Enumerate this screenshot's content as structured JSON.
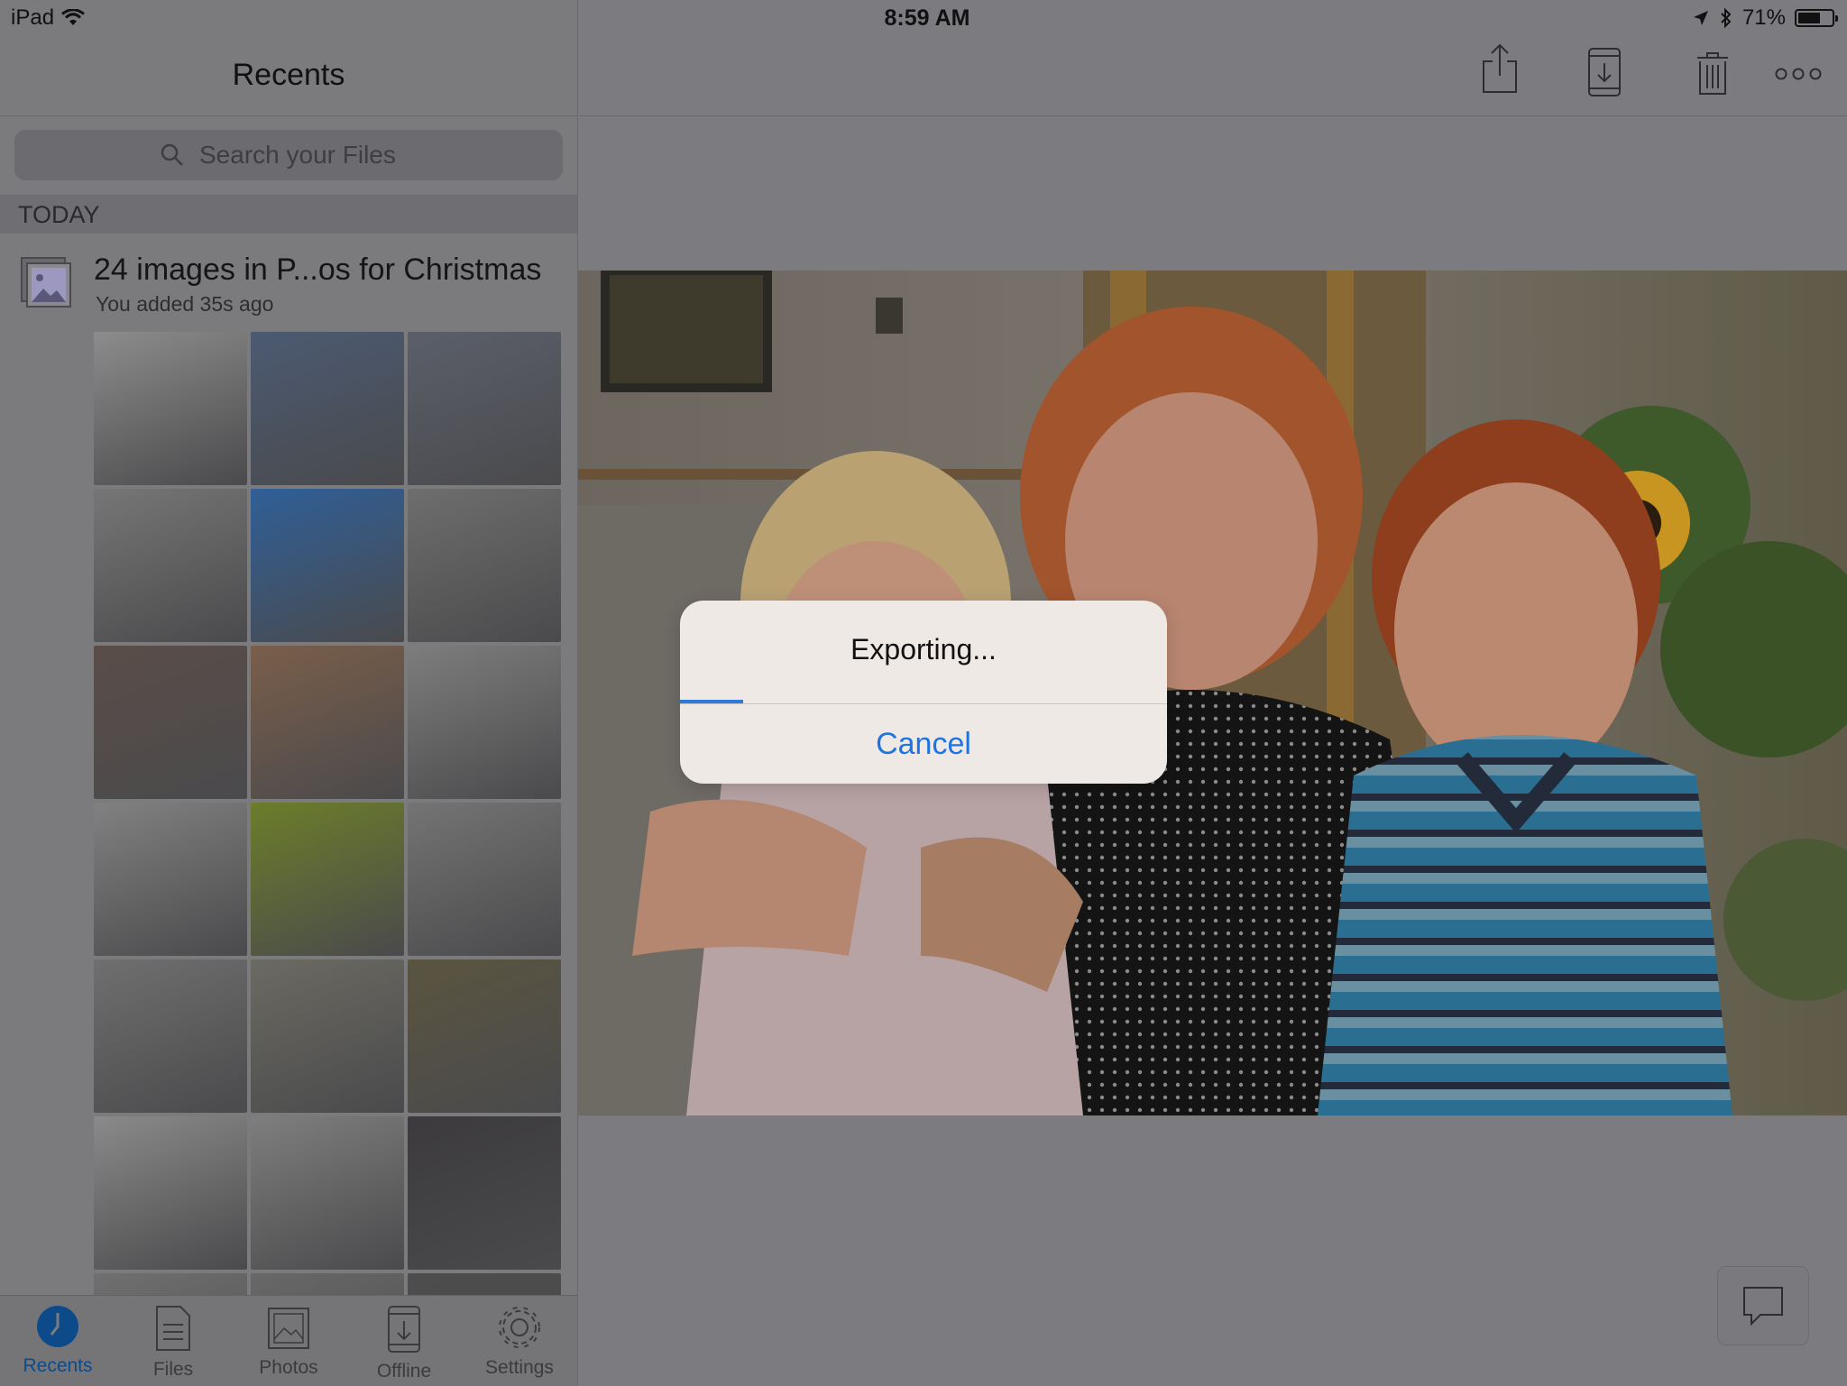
{
  "status_bar": {
    "device": "iPad",
    "time": "8:59 AM",
    "battery_percent": "71%",
    "battery_level": 0.71,
    "icons": [
      "wifi-icon",
      "location-arrow-icon",
      "bluetooth-icon",
      "battery-icon"
    ]
  },
  "sidebar": {
    "title": "Recents",
    "search": {
      "placeholder": "Search your Files",
      "value": ""
    },
    "section": "TODAY",
    "recent_item": {
      "title": "24 images in P...os for Christmas",
      "subtitle": "You added 35s ago"
    },
    "thumbnails": [
      {
        "color": "#8c8c8c"
      },
      {
        "color": "#4b5a72"
      },
      {
        "color": "#5b5f6a"
      },
      {
        "color": "#767676"
      },
      {
        "color": "#2f5f98"
      },
      {
        "color": "#6e6e6e"
      },
      {
        "color": "#5a4d48"
      },
      {
        "color": "#7a5e4a"
      },
      {
        "color": "#7d7d7d"
      },
      {
        "color": "#818181"
      },
      {
        "color": "#6c7d2a"
      },
      {
        "color": "#747474"
      },
      {
        "color": "#6f6f6f"
      },
      {
        "color": "#6b6a62"
      },
      {
        "color": "#5a5540"
      },
      {
        "color": "#8a8a8a"
      },
      {
        "color": "#7e7e7e"
      },
      {
        "color": "#3c3a3d"
      },
      {
        "color": "#707070"
      },
      {
        "color": "#686868"
      },
      {
        "color": "#4d4d4d"
      }
    ]
  },
  "tabs": [
    {
      "label": "Recents",
      "icon": "clock-icon",
      "active": true
    },
    {
      "label": "Files",
      "icon": "files-icon",
      "active": false
    },
    {
      "label": "Photos",
      "icon": "photos-icon",
      "active": false
    },
    {
      "label": "Offline",
      "icon": "offline-icon",
      "active": false
    },
    {
      "label": "Settings",
      "icon": "gear-icon",
      "active": false
    }
  ],
  "toolbar": {
    "icons": [
      "share-icon",
      "save-to-device-icon",
      "trash-icon",
      "more-icon"
    ]
  },
  "alert": {
    "title": "Exporting...",
    "cancel_label": "Cancel",
    "progress": 0.13
  },
  "colors": {
    "accent": "#1e74e0",
    "overlay_gray": "#7c7c80",
    "alert_bg": "#efe9e6"
  }
}
